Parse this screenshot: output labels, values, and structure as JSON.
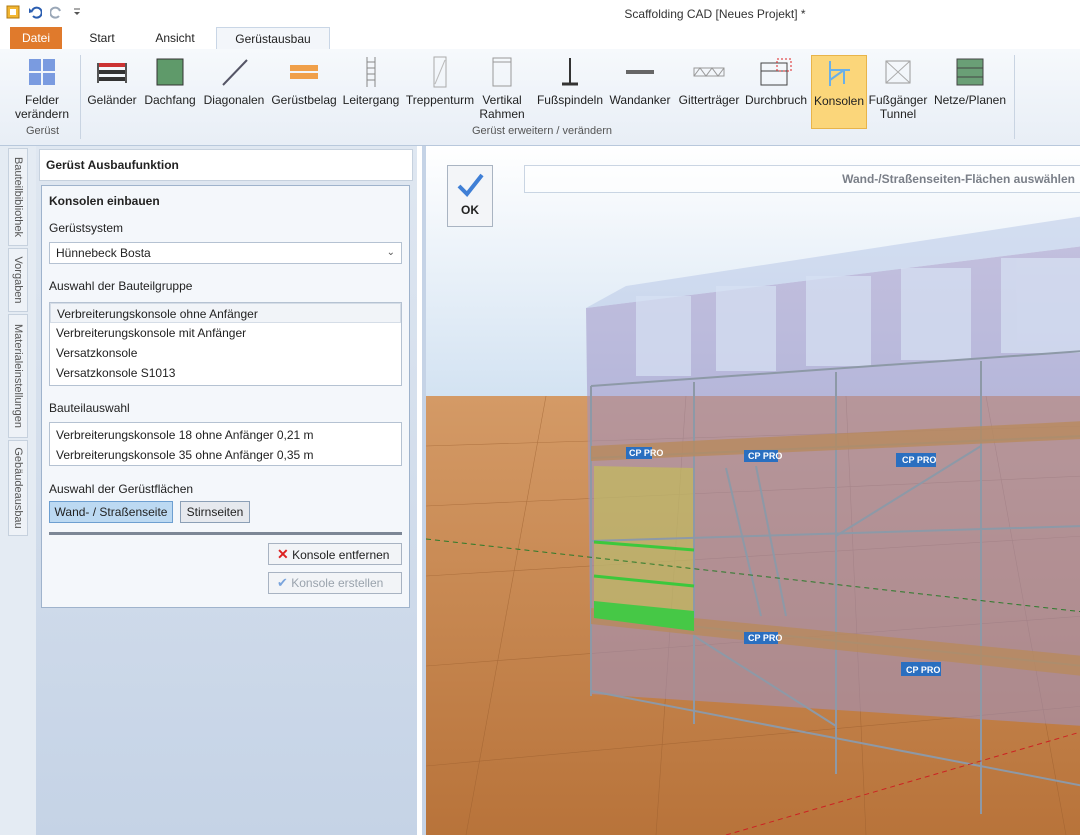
{
  "window": {
    "title": "Scaffolding CAD [Neues Projekt] *"
  },
  "tabs": [
    "Datei",
    "Start",
    "Ansicht",
    "Gerüstausbau"
  ],
  "ribbon": {
    "felder": {
      "line1": "Felder",
      "line2": "verändern",
      "group": "Gerüst"
    },
    "buttons": [
      {
        "label": "Geländer",
        "icon": "railing-icon"
      },
      {
        "label": "Dachfang",
        "icon": "roof-catch-icon"
      },
      {
        "label": "Diagonalen",
        "icon": "diagonal-icon"
      },
      {
        "label": "Gerüstbelag",
        "icon": "deck-icon"
      },
      {
        "label": "Leitergang",
        "icon": "ladder-icon"
      },
      {
        "label": "Treppenturm",
        "icon": "stair-tower-icon"
      },
      {
        "label": "Vertikal",
        "label2": "Rahmen",
        "icon": "vertical-frame-icon"
      },
      {
        "label": "Fußspindeln",
        "icon": "base-jack-icon"
      },
      {
        "label": "Wandanker",
        "icon": "wall-anchor-icon"
      },
      {
        "label": "Gitterträger",
        "icon": "lattice-girder-icon"
      },
      {
        "label": "Durchbruch",
        "icon": "opening-icon"
      },
      {
        "label": "Konsolen",
        "icon": "bracket-icon"
      },
      {
        "label": "Fußgänger",
        "label2": "Tunnel",
        "icon": "pedestrian-tunnel-icon"
      },
      {
        "label": "Netze/Planen",
        "icon": "nets-icon"
      }
    ],
    "group_label": "Gerüst erweitern / verändern"
  },
  "side_tabs": [
    "Bauteilbibliothek",
    "Vorgaben",
    "Materialeinstellungen",
    "Gebäudeausbau"
  ],
  "panel": {
    "header": "Gerüst Ausbaufunktion",
    "title": "Konsolen einbauen",
    "system_label": "Gerüstsystem",
    "system_value": "Hünnebeck Bosta",
    "group_label": "Auswahl der Bauteilgruppe",
    "groups": [
      "Verbreiterungskonsole ohne Anfänger",
      "Verbreiterungskonsole mit Anfänger",
      "Versatzkonsole",
      "Versatzkonsole S1013"
    ],
    "parts_label": "Bauteilauswahl",
    "parts": [
      "Verbreiterungskonsole 18 ohne Anfänger 0,21 m",
      "Verbreiterungskonsole 35 ohne Anfänger 0,35 m"
    ],
    "surfaces_label": "Auswahl der Gerüstflächen",
    "surface_wall": "Wand- / Straßenseite",
    "surface_end": "Stirnseiten",
    "remove": "Konsole entfernen",
    "create": "Konsole erstellen"
  },
  "viewport": {
    "ok": "OK",
    "hint": "Wand-/Straßenseiten-Flächen auswählen",
    "brand": "CP PRO"
  },
  "colors": {
    "accent": "#e07a2c",
    "active": "#fbd67a",
    "ground": "#c88a55"
  }
}
